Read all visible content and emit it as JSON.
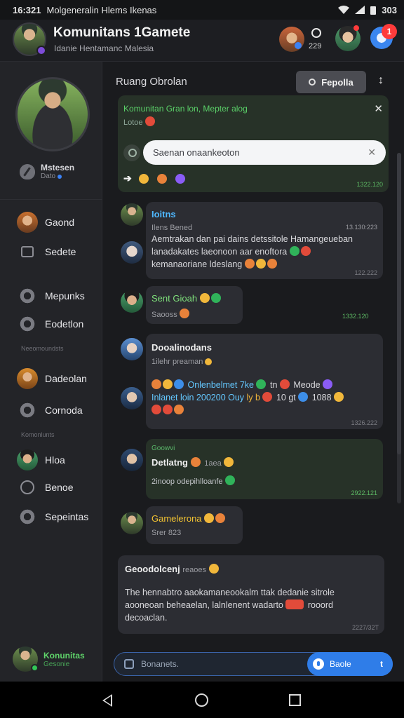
{
  "status_bar": {
    "time": "16:321",
    "title": "Molgeneralin Hlems Ikenas",
    "battery": "303"
  },
  "header": {
    "title": "Komunitans 1Gamete",
    "subtitle": "Idanie Hentamanc Malesia",
    "count": "229",
    "notification_count": "1"
  },
  "sidebar": {
    "profile": {
      "name": "Mstesen",
      "status": "Dato"
    },
    "items": [
      {
        "label": "Gaond"
      },
      {
        "label": "Sedete"
      },
      {
        "label": "Mepunks"
      },
      {
        "label": "Eodetlon"
      },
      {
        "label": "Dadeolan"
      },
      {
        "label": "Cornoda"
      },
      {
        "label": "Hloa"
      },
      {
        "label": "Benoe"
      },
      {
        "label": "Sepeintas"
      }
    ],
    "sections": [
      "Neeomoundsts",
      "Komonlunts"
    ],
    "footer": {
      "title": "Konunitas",
      "sub": "Gesonie"
    }
  },
  "chat": {
    "title": "Ruang Obrolan",
    "profile_button": "Fepolla",
    "pinned": {
      "title": "Komunitan Gran lon, Mepter alog",
      "sub": "Lotoe",
      "search_value": "Saenan onaankeoton",
      "time": "1322.120"
    },
    "messages": [
      {
        "name": "Ioitns",
        "sub": "Ilens Bened",
        "header_time": "13.130:223",
        "text1": "Aemtrakan dan pai dains detssitole Hamangeueban",
        "text2": "lanadakates laeonoon aar enoftora",
        "text3": "kemanaoriane ldeslang",
        "time": "122.222"
      },
      {
        "name": "Sent Gioah",
        "sub": "Saooss",
        "time": "1332.120"
      },
      {
        "name": "Dooalinodans",
        "sub": "1ilehr preaman",
        "line1": "Onlenbelmet 7ke",
        "line1b": "tn",
        "line1c": "Meode",
        "line2": "Inlanet loin 200200 Ouy",
        "line2b": "ly b",
        "line2c": "10 gt",
        "line2d": "1088",
        "time": "1326.222"
      },
      {
        "name_small": "Goowvi",
        "name": "Detlatng",
        "name_tail": "1aea",
        "sub": "2inoop odepihlloanfe",
        "time": "2922.121"
      },
      {
        "name": "Gamelerona",
        "sub": "Srer 823"
      },
      {
        "name": "Geoodolcenj",
        "name_tail": "reaoes",
        "text1": "The hennabtro aaokamaneookalm ttak dedanie sitrole",
        "text2": "aooneoan beheaelan, lalnlenent wadarto",
        "text2b": "rooord",
        "text3": "decoaclan.",
        "time": "2227/32T"
      }
    ],
    "composer": {
      "placeholder": "Bonanets.",
      "send_label": "Baole",
      "send_more": "t"
    }
  },
  "colors": {
    "accent": "#2f7de8",
    "online": "#5ad068",
    "badge": "#ff3b3b",
    "link_name": "#4fb8ff"
  }
}
